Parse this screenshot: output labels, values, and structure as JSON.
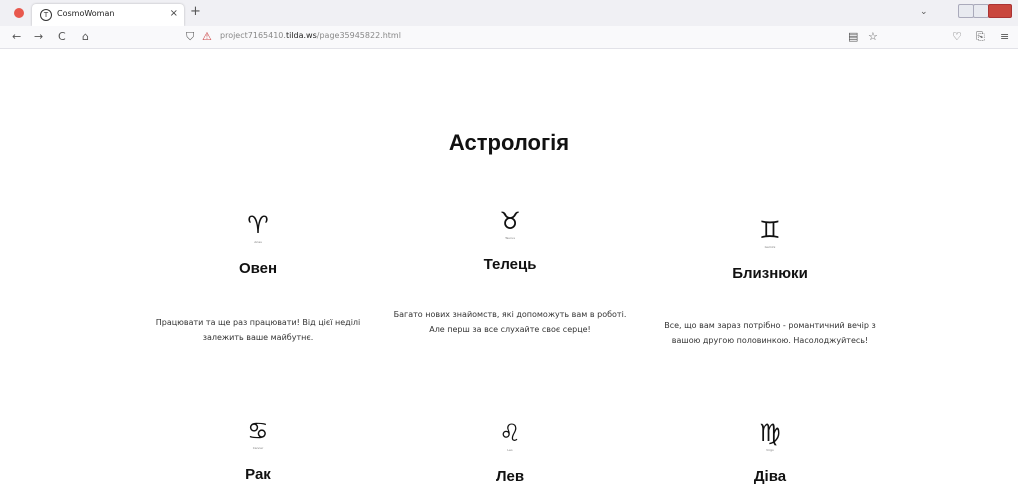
{
  "browser": {
    "tab_title": "CosmoWoman",
    "tab_close": "×",
    "new_tab": "+",
    "list_tabs": "⌄",
    "nav": {
      "back": "←",
      "forward": "→",
      "reload": "C",
      "home": "⌂"
    },
    "shield": "⛉",
    "lock": "⚠",
    "url_prefix": "project7165410.",
    "url_domain": "tilda.ws",
    "url_path": "/page35945822.html",
    "reader": "▤",
    "bookmark": "☆",
    "pocket": "♡",
    "share": "⎘",
    "menu": "≡",
    "colors": {
      "tabbar": "#f0f0f4",
      "navbar": "#f9f9fb",
      "close": "#c9463d"
    }
  },
  "page": {
    "heading": "Астрологія",
    "signs": [
      {
        "glyph": "♈",
        "caption": "Aries",
        "name": "Овен",
        "description": "Працювати та ще раз працювати! Від цієї неділі залежить ваше майбутнє."
      },
      {
        "glyph": "♉",
        "caption": "Taurus",
        "name": "Телець",
        "description": "Багато нових знайомств, які допоможуть вам в роботі. Але перш за все слухайте своє серце!"
      },
      {
        "glyph": "♊",
        "caption": "Gemini",
        "name": "Близнюки",
        "description": "Все, що вам зараз потрібно - романтичний вечір з вашою другою половинкою. Насолоджуйтесь!"
      },
      {
        "glyph": "♋",
        "caption": "Cancer",
        "name": "Рак"
      },
      {
        "glyph": "♌",
        "caption": "Leo",
        "name": "Лев"
      },
      {
        "glyph": "♍",
        "caption": "Virgo",
        "name": "Діва"
      }
    ]
  }
}
